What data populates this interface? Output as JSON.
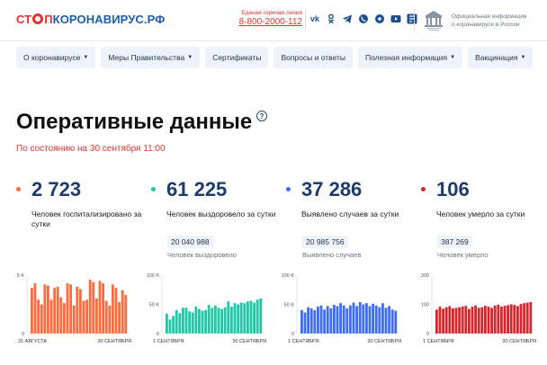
{
  "header": {
    "logo": {
      "part1": "СТ",
      "part2": "П",
      "part3": "КОРОНАВИРУС.РФ"
    },
    "hotline_caption": "Единая горячая линия",
    "hotline_number": "8-800-2000-112",
    "socials": [
      "vk-icon",
      "ok-icon",
      "telegram-icon",
      "viber-icon",
      "odnoklassniki-icon",
      "youtube-icon",
      "yandex-zen-icon"
    ],
    "gov_text_line1": "Официальная информация",
    "gov_text_line2": "о коронавирусе в России"
  },
  "nav": [
    {
      "label": "О коронавирусе",
      "dropdown": true
    },
    {
      "label": "Меры Правительства",
      "dropdown": true
    },
    {
      "label": "Сертификаты",
      "dropdown": false
    },
    {
      "label": "Вопросы и ответы",
      "dropdown": false
    },
    {
      "label": "Полезная информация",
      "dropdown": true
    },
    {
      "label": "Вакцинация",
      "dropdown": true
    }
  ],
  "page": {
    "title": "Оперативные данные",
    "help_glyph": "?",
    "as_of": "По состоянию на 30 сентября 11:00"
  },
  "stats": [
    {
      "value": "2 723",
      "label": "Человек госпитализировано за сутки",
      "total": "",
      "total_label": "",
      "color": "#ff6a3d"
    },
    {
      "value": "61 225",
      "label": "Человек выздоровело за сутки",
      "total": "20 040 988",
      "total_label": "Человек выздоровело",
      "color": "#1dc8a5"
    },
    {
      "value": "37 286",
      "label": "Выявлено случаев за сутки",
      "total": "20 985 756",
      "total_label": "Выявлено случаев",
      "color": "#3e6cf4"
    },
    {
      "value": "106",
      "label": "Человек умерло за сутки",
      "total": "387 269",
      "total_label": "Человек умерло",
      "color": "#d9242b"
    }
  ],
  "chart_data": [
    {
      "type": "bar",
      "color": "#ff6a3d",
      "yticks": [
        "5 K",
        "0"
      ],
      "ylim": [
        0,
        5000
      ],
      "xlabel_start": "31 АВГУСТА",
      "xlabel_end": "30 СЕНТЯБРЯ",
      "values": [
        3900,
        4300,
        2900,
        2500,
        4200,
        4100,
        2900,
        3900,
        4000,
        3100,
        2600,
        4300,
        4200,
        2400,
        4000,
        3800,
        2800,
        2900,
        4600,
        4400,
        3000,
        4500,
        4300,
        2800,
        2400,
        4200,
        3900,
        2700,
        3700,
        3300
      ]
    },
    {
      "type": "bar",
      "color": "#1dc8a5",
      "yticks": [
        "100 K",
        "50 K",
        "0"
      ],
      "ylim": [
        0,
        100000
      ],
      "xlabel_start": "1 СЕНТЯБРЯ",
      "xlabel_end": "30 СЕНТЯБРЯ",
      "values": [
        34000,
        24000,
        30000,
        40000,
        35000,
        44000,
        44000,
        38000,
        36000,
        46000,
        42000,
        39000,
        40000,
        49000,
        44000,
        48000,
        44000,
        42000,
        45000,
        55000,
        46000,
        52000,
        50000,
        53000,
        52000,
        55000,
        56000,
        53000,
        58000,
        60000
      ]
    },
    {
      "type": "bar",
      "color": "#3e6cf4",
      "yticks": [
        "100 K",
        "50 K",
        "0"
      ],
      "ylim": [
        0,
        100000
      ],
      "xlabel_start": "1 СЕНТЯБРЯ",
      "xlabel_end": "30 СЕНТЯБРЯ",
      "values": [
        40000,
        36000,
        45000,
        43000,
        40000,
        46000,
        48000,
        41000,
        47000,
        43000,
        49000,
        47000,
        52000,
        48000,
        43000,
        48000,
        53000,
        47000,
        54000,
        50000,
        52000,
        47000,
        51000,
        48000,
        45000,
        52000,
        44000,
        47000,
        41000,
        39000
      ]
    },
    {
      "type": "bar",
      "color": "#d9242b",
      "yticks": [
        "200",
        "100",
        "0"
      ],
      "ylim": [
        0,
        200
      ],
      "xlabel_start": "1 СЕНТЯБРЯ",
      "xlabel_end": "30 СЕНТЯБРЯ",
      "values": [
        82,
        92,
        85,
        90,
        94,
        86,
        88,
        90,
        93,
        95,
        84,
        92,
        96,
        88,
        90,
        95,
        92,
        88,
        96,
        99,
        92,
        95,
        97,
        100,
        98,
        94,
        101,
        104,
        106,
        108
      ]
    }
  ]
}
